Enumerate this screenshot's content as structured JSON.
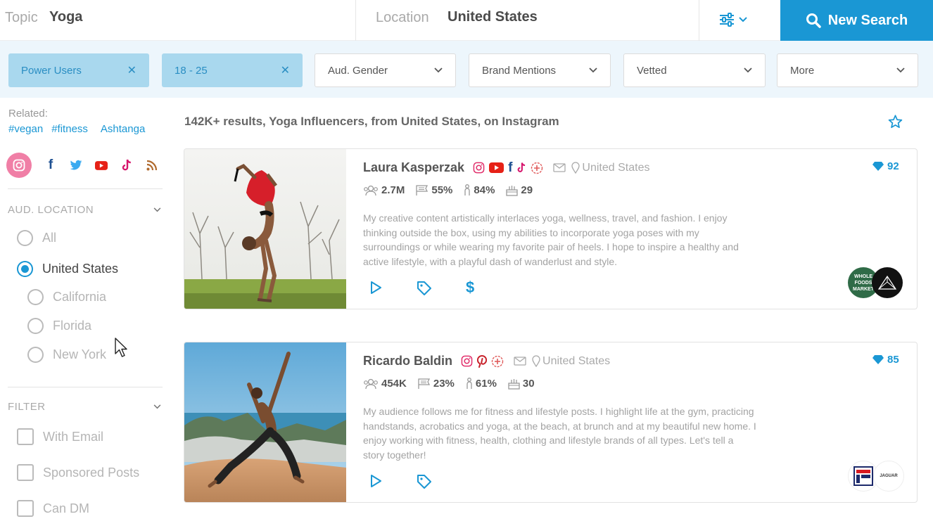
{
  "search": {
    "topic_label": "Topic",
    "topic_value": "Yoga",
    "location_label": "Location",
    "location_value": "United States",
    "new_search_label": "New Search"
  },
  "filters": {
    "selected": [
      {
        "label": "Power Users"
      },
      {
        "label": "18 - 25"
      }
    ],
    "dropdowns": [
      {
        "label": "Aud. Gender"
      },
      {
        "label": "Brand Mentions"
      },
      {
        "label": "Vetted"
      },
      {
        "label": "More"
      }
    ]
  },
  "sidebar": {
    "related_label": "Related:",
    "related_tags": [
      "#vegan",
      "#fitness",
      "Ashtanga"
    ],
    "platforms": [
      "instagram-icon",
      "facebook-icon",
      "twitter-icon",
      "youtube-icon",
      "tiktok-icon",
      "rss-icon"
    ],
    "aud_location": {
      "title": "AUD. LOCATION",
      "options": [
        {
          "label": "All"
        },
        {
          "label": "United States"
        },
        {
          "label": "California"
        },
        {
          "label": "Florida"
        },
        {
          "label": "New York"
        }
      ],
      "selected": "United States"
    },
    "filter": {
      "title": "FILTER",
      "options": [
        {
          "label": "With Email"
        },
        {
          "label": "Sponsored Posts"
        },
        {
          "label": "Can DM"
        }
      ]
    }
  },
  "results": {
    "summary": "142K+ results, Yoga Influencers, from United States, on Instagram"
  },
  "influencers": [
    {
      "name": "Laura Kasperzak",
      "location": "United States",
      "followers": "2.7M",
      "stat2": "55%",
      "stat3": "84%",
      "stat4": "29",
      "score": "92",
      "bio": "My creative content artistically interlaces yoga, wellness, travel, and fashion. I enjoy thinking outside the box, using my abilities to incorporate yoga poses with my surroundings or while wearing my favorite pair of heels. I hope to inspire a healthy and active lifestyle, with a playful dash of wanderlust and style.",
      "brands": [
        "WHOLE FOODS MARKET",
        ""
      ]
    },
    {
      "name": "Ricardo Baldin",
      "location": "United States",
      "followers": "454K",
      "stat2": "23%",
      "stat3": "61%",
      "stat4": "30",
      "score": "85",
      "bio": "My audience follows me for fitness and lifestyle posts. I highlight life at the gym, practicing handstands, acrobatics and yoga, at the beach, at brunch and at my beautiful new home. I enjoy working with fitness, health, clothing and lifestyle brands of all types. Let's tell a story together!",
      "brands": [
        "",
        "JAGUAR"
      ]
    }
  ],
  "colors": {
    "accent": "#1a97d4",
    "chip": "#a9d8ee",
    "filter_bar": "#edf6fc",
    "instagram": "#e1306c",
    "youtube": "#e62117",
    "facebook": "#1d4f91",
    "pinterest": "#c8232c"
  }
}
